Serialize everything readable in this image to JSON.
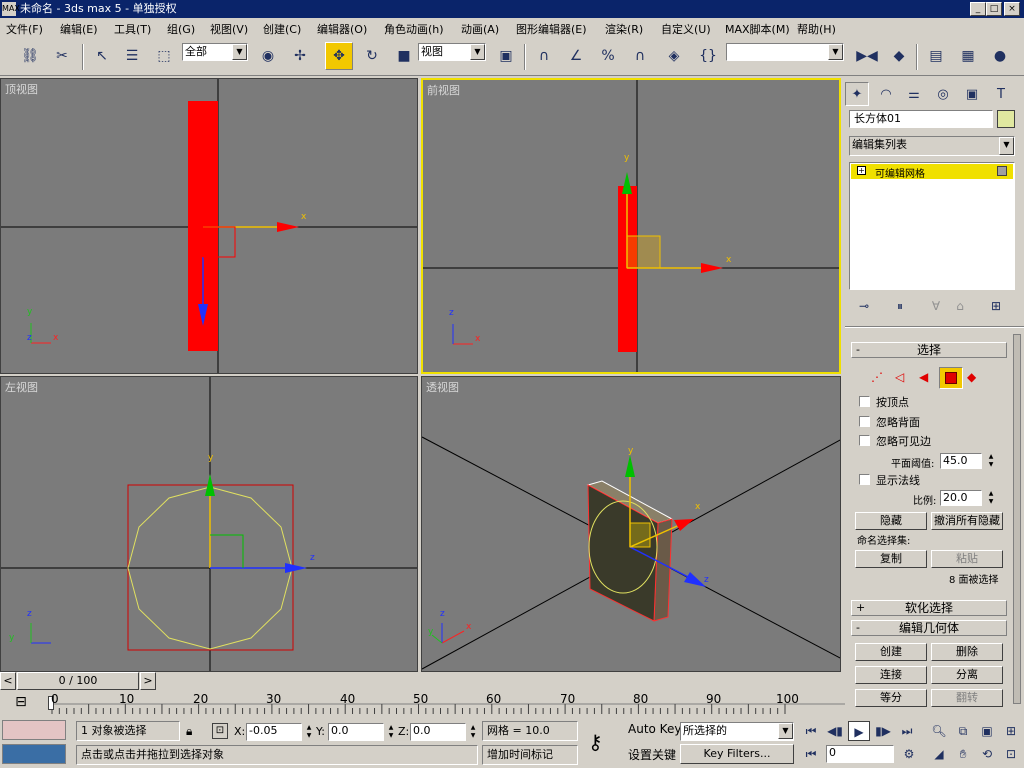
{
  "window": {
    "icon": "MAX",
    "title": "未命名 - 3ds max 5 - 单独授权",
    "min": "_",
    "max": "□",
    "close": "×"
  },
  "menu": [
    "文件(F)",
    "编辑(E)",
    "工具(T)",
    "组(G)",
    "视图(V)",
    "创建(C)",
    "编辑器(O)",
    "角色动画(h)",
    "动画(A)",
    "图形编辑器(E)",
    "渲染(R)",
    "自定义(U)",
    "MAX脚本(M)",
    "帮助(H)"
  ],
  "toolbar": {
    "selection_filter": "全部",
    "ref_coord": "视图",
    "named_sel": ""
  },
  "viewports": {
    "top": "顶视图",
    "front": "前视图",
    "left": "左视图",
    "persp": "透视图"
  },
  "axes": {
    "x": "x",
    "y": "y",
    "z": "z"
  },
  "command_panel": {
    "object_name": "长方体01",
    "color_swatch": "#e0e8a0",
    "modifier_list": "编辑集列表",
    "stack_item": "可编辑网格",
    "stack_expand": "+",
    "selection_rollout": {
      "toggle": "-",
      "title": "选择"
    },
    "by_vertex": "按顶点",
    "ignore_backface": "忽略背面",
    "ignore_visible_edges": "忽略可见边",
    "plane_thresh_label": "平面阈值:",
    "plane_thresh_value": "45.0",
    "show_normals": "显示法线",
    "scale_label": "比例:",
    "scale_value": "20.0",
    "hide": "隐藏",
    "unhide_all": "撤消所有隐藏",
    "named_sel_label": "命名选择集:",
    "copy": "复制",
    "paste": "粘贴",
    "sel_count": "8 面被选择",
    "soft_selection": {
      "toggle": "+",
      "title": "软化选择"
    },
    "edit_geometry": {
      "toggle": "-",
      "title": "编辑几何体"
    },
    "create": "创建",
    "delete": "删除",
    "attach": "连接",
    "detach": "分离",
    "divide": "等分",
    "turn": "翻转"
  },
  "timeline": {
    "frame": "0 / 100",
    "prev": "<",
    "next": ">",
    "ticks": [
      "0",
      "10",
      "20",
      "30",
      "40",
      "50",
      "60",
      "70",
      "80",
      "90",
      "100"
    ]
  },
  "status": {
    "selected": "1 对象被选择",
    "x_label": "X:",
    "x": "-0.05",
    "y_label": "Y:",
    "y": "0.0",
    "z_label": "Z:",
    "z": "0.0",
    "grid": "网格 = 10.0",
    "prompt": "点击或点击并拖拉到选择对象",
    "add_time_tag": "增加时间标记",
    "auto_key": "Auto Key",
    "set_key": "设置关键帧",
    "key_mode": "所选择的",
    "key_filters": "Key Filters...",
    "current_frame": "0"
  }
}
